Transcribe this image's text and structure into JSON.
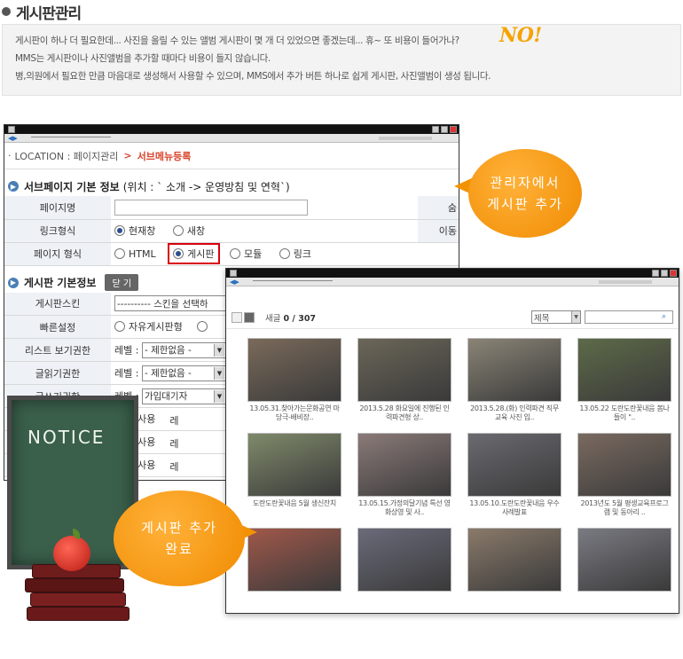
{
  "header": {
    "title": "게시판관리"
  },
  "intro": {
    "line1": "게시판이 하나 더 필요한데... 사진을 올릴 수 있는 앨범 게시판이 몇 개 더 있었으면 좋겠는데... 휴~ 또 비용이 들어가나?",
    "no_text": "NO!",
    "line2": "MMS는 게시판이나 사진앨범을 추가할 때마다 비용이 들지 않습니다.",
    "line3": "병,의원에서 필요한 만큼 마음대로 생성해서 사용할 수 있으며, MMS에서 추가 버튼 하나로 쉽게 게시판, 사진앨범이 생성 됩니다."
  },
  "admin_window": {
    "location_label": "LOCATION : 페이지관리",
    "location_arrow": ">",
    "location_current": "서브메뉴등록",
    "section1": {
      "title": "서브페이지 기본 정보",
      "subtitle": "(위치 : ` 소개 -> 운영방침 및 연혁`)"
    },
    "rows1": {
      "page_name": {
        "label": "페이지명",
        "right_label": "숨"
      },
      "link_type": {
        "label": "링크형식",
        "opt1": "현재창",
        "opt2": "새창",
        "right_label": "이동"
      },
      "page_type": {
        "label": "페이지 형식",
        "opt1": "HTML",
        "opt2": "게시판",
        "opt3": "모듈",
        "opt4": "링크"
      }
    },
    "section2": {
      "title": "게시판 기본정보",
      "button": "닫 기"
    },
    "rows2": {
      "skin": {
        "label": "게시판스킨",
        "value": "---------- 스킨을 선택하"
      },
      "quick": {
        "label": "빠른설정",
        "opt1": "자유게시판형"
      },
      "list_perm": {
        "label": "리스트 보기권한",
        "prefix": "레벨 :",
        "value": "- 제한없음 -"
      },
      "read_perm": {
        "label": "글읽기권한",
        "prefix": "레벨 :",
        "value": "- 제한없음 -"
      },
      "write_perm": {
        "label": "글쓰기권한",
        "prefix": "레벨 :",
        "value": "가입대기자"
      },
      "opt_a": {
        "prefix": "용",
        "value": "미사용",
        "suffix": "레"
      },
      "opt_b": {
        "prefix": "용",
        "value": "미사용",
        "suffix": "레"
      },
      "opt_c": {
        "prefix": "용",
        "value": "미사용",
        "suffix": "레"
      }
    }
  },
  "callout_top": {
    "line1": "관리자에서",
    "line2": "게시판 추가"
  },
  "callout_bottom": {
    "line1": "게시판 추가",
    "line2": "완료"
  },
  "notice_board": {
    "text": "NOTICE"
  },
  "gallery_window": {
    "count_label": "새글",
    "count_value": "0 / 307",
    "select_value": "제목",
    "items": [
      {
        "caption": "13.05.31.찾아가는문화공연 마당극-배비장..",
        "color": "#7a6a5a"
      },
      {
        "caption": "2013.5.28 화요일에 진행된 인력파견형 상..",
        "color": "#6b6658"
      },
      {
        "caption": "2013.5.28.(화) 인력파견 직무교육 사진 입..",
        "color": "#8a8476"
      },
      {
        "caption": "13.05.22 도란도란꽃내음 봄나들이 \"..",
        "color": "#5d6a48"
      },
      {
        "caption": "도란도란꽃내음 5월 생신잔치",
        "color": "#7f8a6a"
      },
      {
        "caption": "13.05.15.가정의달기념 특선 영화상영 및 사..",
        "color": "#8a7a78"
      },
      {
        "caption": "13.05.10.도란도란꽃내음 우수사례발표",
        "color": "#6a6a70"
      },
      {
        "caption": "2013년도 5월 평생교육프로그램 및 동아리 ..",
        "color": "#7a6a60"
      },
      {
        "caption": "",
        "color": "#a0584a"
      },
      {
        "caption": "",
        "color": "#6a6a7a"
      },
      {
        "caption": "",
        "color": "#8a7a6a"
      },
      {
        "caption": "",
        "color": "#7a7a82"
      }
    ]
  }
}
